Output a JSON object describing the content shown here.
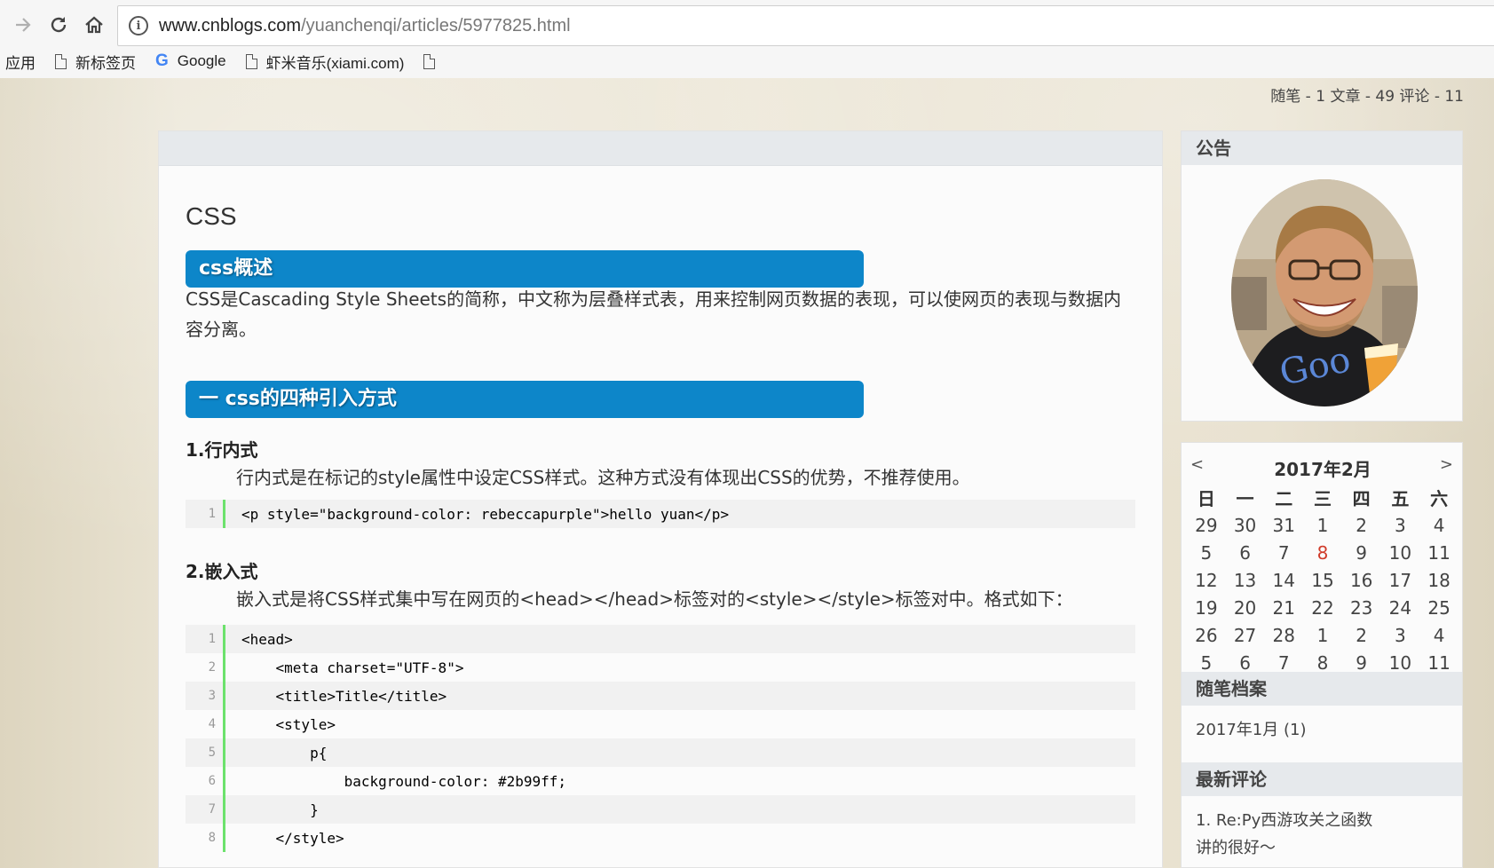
{
  "browser": {
    "url_host": "www.cnblogs.com",
    "url_path": "/yuanchenqi/articles/5977825.html",
    "bookmarks": [
      {
        "label": "应用",
        "icon": "none"
      },
      {
        "label": "新标签页",
        "icon": "page-icon"
      },
      {
        "label": "Google",
        "icon": "google-icon"
      },
      {
        "label": "虾米音乐(xiami.com)",
        "icon": "page-icon"
      },
      {
        "label": "",
        "icon": "page-icon"
      }
    ]
  },
  "stats": "随笔 - 1  文章 - 49  评论 - 11",
  "post": {
    "title": "CSS",
    "section1": "css概述",
    "intro": "CSS是Cascading Style Sheets的简称，中文称为层叠样式表，用来控制网页数据的表现，可以使网页的表现与数据内容分离。",
    "section2": "一 css的四种引入方式",
    "inline_heading": "1.行内式",
    "inline_desc": "行内式是在标记的style属性中设定CSS样式。这种方式没有体现出CSS的优势，不推荐使用。",
    "inline_code": "<p style=\"background-color: rebeccapurple\">hello yuan</p>",
    "embed_heading": "2.嵌入式",
    "embed_desc": "嵌入式是将CSS样式集中写在网页的<head></head>标签对的<style></style>标签对中。格式如下：",
    "embed_code": [
      {
        "n": "1",
        "text": "<head>"
      },
      {
        "n": "2",
        "text": "    <meta charset=\"UTF-8\">"
      },
      {
        "n": "3",
        "text": "    <title>Title</title>"
      },
      {
        "n": "4",
        "text": "    <style>"
      },
      {
        "n": "5",
        "text": "        p{"
      },
      {
        "n": "6",
        "text": "            background-color: #2b99ff;"
      },
      {
        "n": "7",
        "text": "        }"
      },
      {
        "n": "8",
        "text": "    </style>"
      }
    ]
  },
  "sidebar": {
    "notice_title": "公告",
    "calendar": {
      "title": "2017年2月",
      "prev": "<",
      "next": ">",
      "weekdays": [
        "日",
        "一",
        "二",
        "三",
        "四",
        "五",
        "六"
      ],
      "weeks": [
        [
          "29",
          "30",
          "31",
          "1",
          "2",
          "3",
          "4"
        ],
        [
          "5",
          "6",
          "7",
          "8",
          "9",
          "10",
          "11"
        ],
        [
          "12",
          "13",
          "14",
          "15",
          "16",
          "17",
          "18"
        ],
        [
          "19",
          "20",
          "21",
          "22",
          "23",
          "24",
          "25"
        ],
        [
          "26",
          "27",
          "28",
          "1",
          "2",
          "3",
          "4"
        ],
        [
          "5",
          "6",
          "7",
          "8",
          "9",
          "10",
          "11"
        ]
      ],
      "highlight_color": "#d03b2a"
    },
    "archive_title": "随笔档案",
    "archive_items": [
      "2017年1月 (1)"
    ],
    "comments_title": "最新评论",
    "comments": [
      "1. Re:Py西游攻关之函数",
      "讲的很好～"
    ]
  },
  "colors": {
    "heading_bar": "#0d86c9",
    "code_gutter": "#6ce26c"
  }
}
